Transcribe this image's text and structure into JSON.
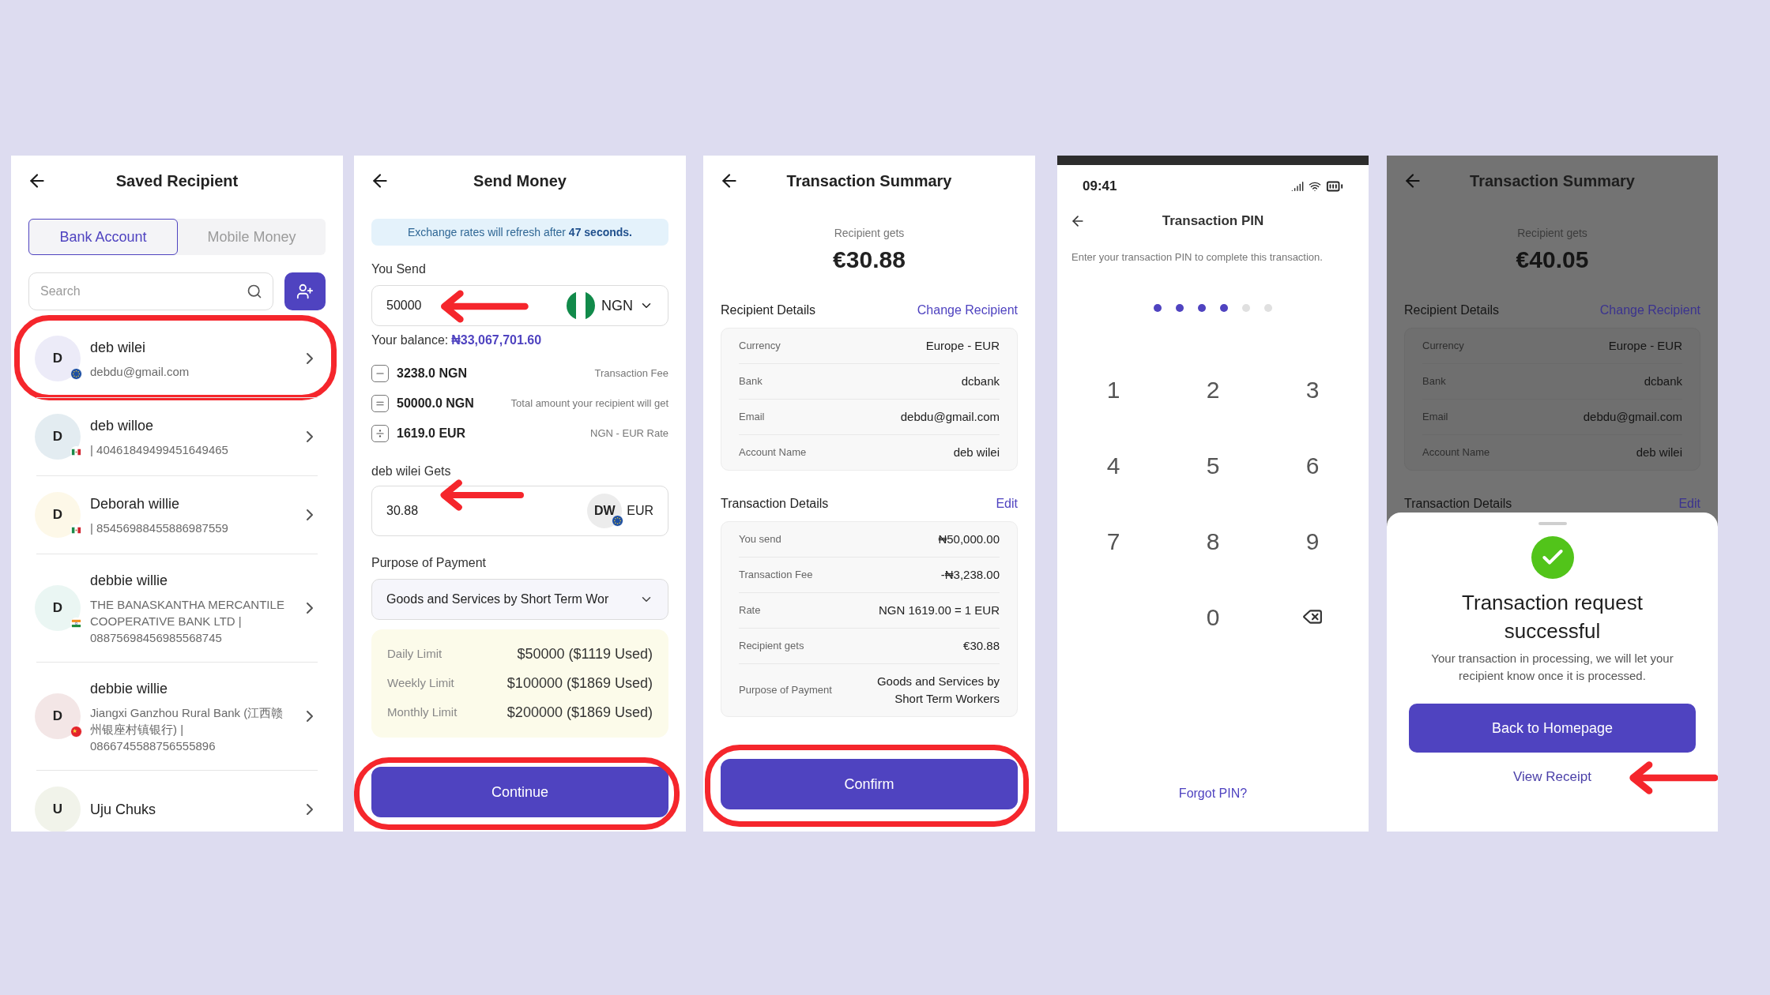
{
  "screens": [
    {
      "kind": "recipients",
      "title": "Saved Recipient",
      "tabs": [
        {
          "label": "Bank Account",
          "selected": true
        },
        {
          "label": "Mobile Money",
          "selected": false
        }
      ],
      "search": {
        "placeholder": "Search"
      },
      "recipients": [
        {
          "initial": "D",
          "name": "deb wilei",
          "detail": "debdu@gmail.com",
          "kind": "eu",
          "color": "#ecebf8",
          "annotated": true
        },
        {
          "initial": "D",
          "name": "deb willoe",
          "detail": "| 40461849499451649465",
          "kind": "mx",
          "color": "#e3ecf1",
          "annotated": false
        },
        {
          "initial": "D",
          "name": "Deborah willie",
          "detail": "| 85456988455886987559",
          "kind": "mx",
          "color": "#fdf8e8",
          "annotated": false
        },
        {
          "initial": "D",
          "name": "debbie willie",
          "detail": "THE BANASKANTHA MERCANTILE COOPERATIVE BANK LTD | 08875698456985568745",
          "kind": "in",
          "color": "#eaf6f3",
          "annotated": false
        },
        {
          "initial": "D",
          "name": "debbie willie",
          "detail": "Jiangxi Ganzhou Rural Bank (江西赣州银座村镇银行) | 0866745588756555896",
          "kind": "cn",
          "color": "#f3e6e6",
          "annotated": false
        },
        {
          "initial": "U",
          "name": "Uju Chuks",
          "color": "#f1f3ea",
          "annotated": false
        }
      ]
    },
    {
      "kind": "send",
      "title": "Send Money",
      "notice": "Exchange rates will refresh after **47 seconds.**",
      "send_label": "You Send",
      "send_amount": "50000",
      "send_pointed": true,
      "send_currency": "NGN",
      "balance_label": "Your balance:",
      "balance": "₦33,067,701.60",
      "breakdown": [
        {
          "kind": "minus",
          "amount": "3238.0 NGN",
          "note": "Transaction Fee"
        },
        {
          "kind": "equals",
          "amount": "50000.0 NGN",
          "note": "Total amount your recipient will get"
        },
        {
          "kind": "divide",
          "amount": "1619.0 EUR",
          "note": "NGN - EUR Rate"
        }
      ],
      "gets_label": "deb wilei Gets",
      "gets_amount": "30.88",
      "gets_pointed": true,
      "gets_avatar": "DW",
      "gets_currency": "EUR",
      "purpose_label": "Purpose of Payment",
      "purpose": "Goods and Services by Short Term Wor",
      "limits": [
        {
          "label": "Daily Limit",
          "value": "$50000 ($1119 Used)"
        },
        {
          "label": "Weekly Limit",
          "value": "$100000 ($1869 Used)"
        },
        {
          "label": "Monthly Limit",
          "value": "$200000 ($1869 Used)"
        }
      ],
      "button": {
        "label": "Continue",
        "annotated": true
      }
    },
    {
      "kind": "summary",
      "dimmed": false,
      "title": "Transaction Summary",
      "gets_label": "Recipient gets",
      "gets_amount": "€30.88",
      "sections": [
        {
          "title": "Recipient Details",
          "action": "Change Recipient",
          "rows": [
            {
              "label": "Currency",
              "value": "Europe - EUR"
            },
            {
              "label": "Bank",
              "value": "dcbank"
            },
            {
              "label": "Email",
              "value": "debdu@gmail.com"
            },
            {
              "label": "Account Name",
              "value": "deb wilei"
            }
          ]
        },
        {
          "title": "Transaction Details",
          "action": "Edit",
          "rows": [
            {
              "label": "You send",
              "value": "₦50,000.00"
            },
            {
              "label": "Transaction Fee",
              "value": "-₦3,238.00"
            },
            {
              "label": "Rate",
              "value": "NGN 1619.00 = 1 EUR"
            },
            {
              "label": "Recipient gets",
              "value": "€30.88"
            },
            {
              "label": "Purpose of Payment",
              "value": "Goods and Services by Short Term Workers"
            }
          ]
        }
      ],
      "button": {
        "label": "Confirm",
        "annotated": true
      }
    },
    {
      "kind": "pin",
      "time": "09:41",
      "title": "Transaction PIN",
      "instruction": "Enter your transaction PIN to complete this transaction.",
      "pin_dots": [
        {
          "filled": true
        },
        {
          "filled": true
        },
        {
          "filled": true
        },
        {
          "filled": true
        },
        {
          "filled": false
        },
        {
          "filled": false
        }
      ],
      "keys": [
        {
          "kind": "digit",
          "label": "1"
        },
        {
          "kind": "digit",
          "label": "2"
        },
        {
          "kind": "digit",
          "label": "3"
        },
        {
          "kind": "digit",
          "label": "4"
        },
        {
          "kind": "digit",
          "label": "5"
        },
        {
          "kind": "digit",
          "label": "6"
        },
        {
          "kind": "digit",
          "label": "7"
        },
        {
          "kind": "digit",
          "label": "8"
        },
        {
          "kind": "digit",
          "label": "9"
        },
        {
          "kind": "blank"
        },
        {
          "kind": "digit",
          "label": "0"
        },
        {
          "kind": "backspace"
        }
      ],
      "link": "Forgot PIN?"
    },
    {
      "kind": "summary",
      "dimmed": true,
      "title": "Transaction Summary",
      "gets_label": "Recipient gets",
      "gets_amount": "€40.05",
      "sections": [
        {
          "title": "Recipient Details",
          "action": "Change Recipient",
          "rows": [
            {
              "label": "Currency",
              "value": "Europe - EUR"
            },
            {
              "label": "Bank",
              "value": "dcbank"
            },
            {
              "label": "Email",
              "value": "debdu@gmail.com"
            },
            {
              "label": "Account Name",
              "value": "deb wilei"
            }
          ]
        },
        {
          "title": "Transaction Details",
          "action": "Edit"
        }
      ],
      "sheet": {
        "title": "Transaction request successful",
        "message": "Your transaction in processing, we will let your recipient know once it is processed.",
        "button": "Back to Homepage",
        "link": "View Receipt",
        "link_pointed": true
      }
    }
  ]
}
